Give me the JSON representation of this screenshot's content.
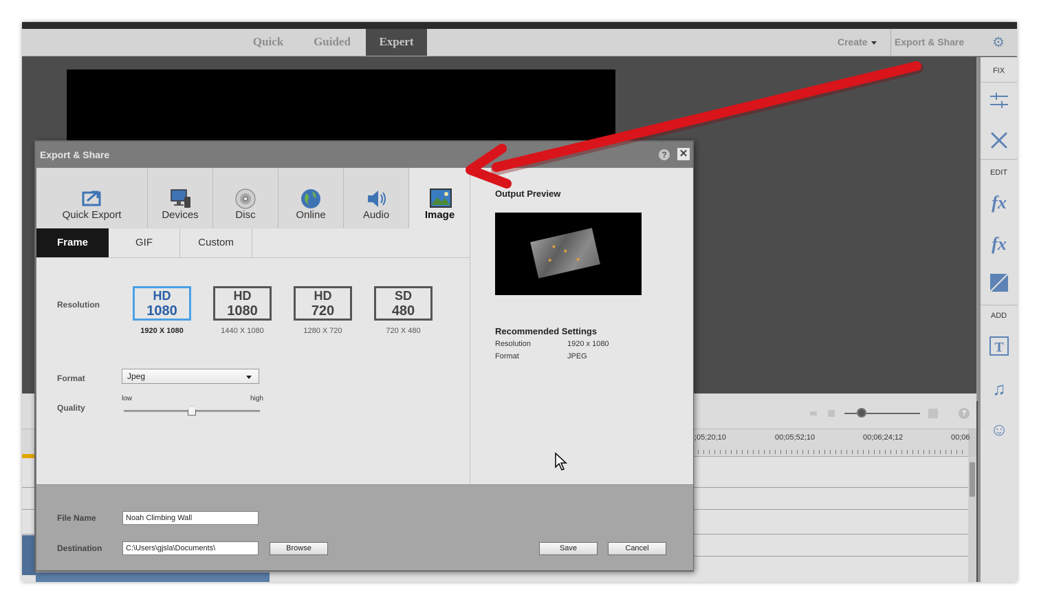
{
  "topbar": {
    "modes": [
      "Quick",
      "Guided",
      "Expert"
    ],
    "active_mode": "Expert",
    "create_label": "Create",
    "export_share_label": "Export & Share"
  },
  "right_panel": {
    "sections": [
      {
        "label": "FIX",
        "icons": [
          "adjustments-icon",
          "tools-icon"
        ]
      },
      {
        "label": "EDIT",
        "icons": [
          "fx-edit-icon",
          "fx-icon",
          "transition-icon"
        ]
      },
      {
        "label": "ADD",
        "icons": [
          "title-icon",
          "music-icon",
          "smiley-icon"
        ]
      }
    ]
  },
  "timeline": {
    "timecodes": [
      ";05;20;10",
      "00;05;52;10",
      "00;06;24;12",
      "00;06"
    ]
  },
  "dialog": {
    "title": "Export & Share",
    "help_label": "?",
    "close_label": "✕",
    "categories": [
      {
        "label": "Quick Export",
        "icon": "quick-export-icon"
      },
      {
        "label": "Devices",
        "icon": "devices-icon"
      },
      {
        "label": "Disc",
        "icon": "disc-icon"
      },
      {
        "label": "Online",
        "icon": "globe-icon"
      },
      {
        "label": "Audio",
        "icon": "speaker-icon"
      },
      {
        "label": "Image",
        "icon": "image-icon"
      }
    ],
    "active_category": "Image",
    "subtabs": [
      "Frame",
      "GIF",
      "Custom"
    ],
    "active_subtab": "Frame",
    "resolution": {
      "label": "Resolution",
      "options": [
        {
          "line1": "HD",
          "line2": "1080",
          "sub": "1920 X 1080",
          "selected": true
        },
        {
          "line1": "HD",
          "line2": "1080",
          "sub": "1440 X 1080",
          "selected": false
        },
        {
          "line1": "HD",
          "line2": "720",
          "sub": "1280 X 720",
          "selected": false
        },
        {
          "line1": "SD",
          "line2": "480",
          "sub": "720 X 480",
          "selected": false
        }
      ]
    },
    "format": {
      "label": "Format",
      "value": "Jpeg"
    },
    "quality": {
      "label": "Quality",
      "low": "low",
      "high": "high",
      "value": 0.5
    },
    "output_preview": {
      "title": "Output Preview"
    },
    "recommended": {
      "title": "Recommended Settings",
      "resolution_label": "Resolution",
      "resolution_value": "1920 x 1080",
      "format_label": "Format",
      "format_value": "JPEG"
    },
    "footer": {
      "file_name_label": "File Name",
      "file_name_value": "Noah Climbing Wall",
      "destination_label": "Destination",
      "destination_value": "C:\\Users\\gjsla\\Documents\\",
      "browse_label": "Browse",
      "save_label": "Save",
      "cancel_label": "Cancel"
    }
  },
  "colors": {
    "accent_selected": "#4aa0e6",
    "annotation_arrow": "#d9141a",
    "active_subtab_bg": "#171717"
  }
}
